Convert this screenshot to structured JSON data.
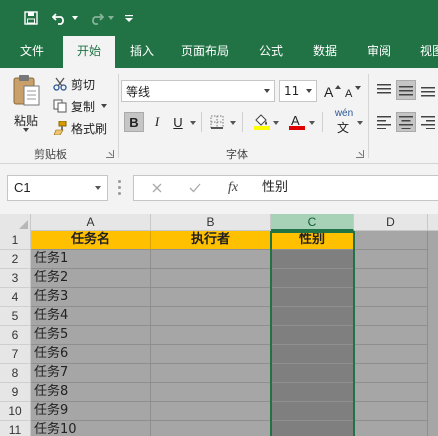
{
  "qat": {
    "icons": [
      "save-icon",
      "undo-icon",
      "redo-icon",
      "customize-qat-icon"
    ]
  },
  "tabs": [
    "文件",
    "开始",
    "插入",
    "页面布局",
    "公式",
    "数据",
    "审阅",
    "视图"
  ],
  "active_tab": "开始",
  "clipboard": {
    "paste_label": "粘贴",
    "cut_label": "剪切",
    "copy_label": "复制",
    "format_painter_label": "格式刷",
    "group_label": "剪贴板"
  },
  "font": {
    "font_name": "等线",
    "font_size": "11",
    "bold": "B",
    "italic": "I",
    "underline": "U",
    "phonetic": "wén",
    "group_label": "字体"
  },
  "formula_bar": {
    "name_box": "C1",
    "fx_label": "fx",
    "content": "性别"
  },
  "grid": {
    "columns": [
      "A",
      "B",
      "C",
      "D"
    ],
    "selected_column": "C",
    "rows": [
      {
        "n": "1",
        "a": "任务名",
        "b": "执行者",
        "c": "性别"
      },
      {
        "n": "2",
        "a": "任务1",
        "b": "",
        "c": ""
      },
      {
        "n": "3",
        "a": "任务2",
        "b": "",
        "c": ""
      },
      {
        "n": "4",
        "a": "任务3",
        "b": "",
        "c": ""
      },
      {
        "n": "5",
        "a": "任务4",
        "b": "",
        "c": ""
      },
      {
        "n": "6",
        "a": "任务5",
        "b": "",
        "c": ""
      },
      {
        "n": "7",
        "a": "任务6",
        "b": "",
        "c": ""
      },
      {
        "n": "8",
        "a": "任务7",
        "b": "",
        "c": ""
      },
      {
        "n": "9",
        "a": "任务8",
        "b": "",
        "c": ""
      },
      {
        "n": "10",
        "a": "任务9",
        "b": "",
        "c": ""
      },
      {
        "n": "11",
        "a": "任务10",
        "b": "",
        "c": ""
      }
    ]
  },
  "colors": {
    "excel_green": "#217346",
    "header_fill": "#ffc000",
    "selected_col_fill": "#7f7f7f",
    "sheet_gray": "#a6a6a6"
  }
}
